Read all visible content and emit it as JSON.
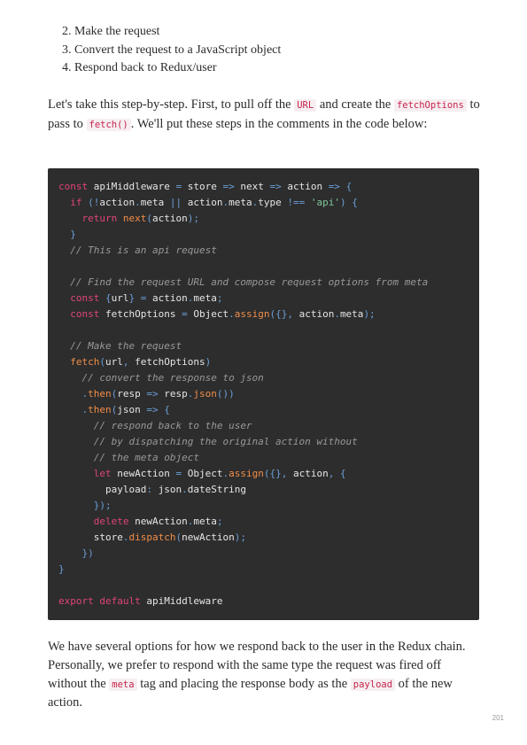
{
  "steps": [
    {
      "num": "2.",
      "text": "Make the request"
    },
    {
      "num": "3.",
      "text": "Convert the request to a JavaScript object"
    },
    {
      "num": "4.",
      "text": "Respond back to Redux/user"
    }
  ],
  "intro": {
    "t1": "Let's take this step-by-step. First, to pull off the ",
    "c1": "URL",
    "t2": " and create the ",
    "c2": "fetchOptions",
    "t3": " to pass to ",
    "c3": "fetch()",
    "t4": ". We'll put these steps in the comments in the code below:"
  },
  "code_lines": [
    [
      [
        "k",
        "const"
      ],
      [
        "t",
        " apiMiddleware "
      ],
      [
        "p",
        "="
      ],
      [
        "t",
        " store "
      ],
      [
        "p",
        "=>"
      ],
      [
        "t",
        " next "
      ],
      [
        "p",
        "=>"
      ],
      [
        "t",
        " action "
      ],
      [
        "p",
        "=>"
      ],
      [
        "t",
        " "
      ],
      [
        "p",
        "{"
      ]
    ],
    [
      [
        "t",
        "  "
      ],
      [
        "k",
        "if"
      ],
      [
        "t",
        " "
      ],
      [
        "p",
        "(!"
      ],
      [
        "t",
        "action"
      ],
      [
        "p",
        "."
      ],
      [
        "t",
        "meta "
      ],
      [
        "p",
        "||"
      ],
      [
        "t",
        " action"
      ],
      [
        "p",
        "."
      ],
      [
        "t",
        "meta"
      ],
      [
        "p",
        "."
      ],
      [
        "t",
        "type "
      ],
      [
        "p",
        "!=="
      ],
      [
        "t",
        " "
      ],
      [
        "s",
        "'api'"
      ],
      [
        "p",
        ")"
      ],
      [
        "t",
        " "
      ],
      [
        "p",
        "{"
      ]
    ],
    [
      [
        "t",
        "    "
      ],
      [
        "k",
        "return"
      ],
      [
        "t",
        " "
      ],
      [
        "f",
        "next"
      ],
      [
        "p",
        "("
      ],
      [
        "t",
        "action"
      ],
      [
        "p",
        ");"
      ]
    ],
    [
      [
        "t",
        "  "
      ],
      [
        "p",
        "}"
      ]
    ],
    [
      [
        "t",
        "  "
      ],
      [
        "c",
        "// This is an api request"
      ]
    ],
    [
      [
        "t",
        ""
      ]
    ],
    [
      [
        "t",
        "  "
      ],
      [
        "c",
        "// Find the request URL and compose request options from meta"
      ]
    ],
    [
      [
        "t",
        "  "
      ],
      [
        "k",
        "const"
      ],
      [
        "t",
        " "
      ],
      [
        "p",
        "{"
      ],
      [
        "t",
        "url"
      ],
      [
        "p",
        "}"
      ],
      [
        "t",
        " "
      ],
      [
        "p",
        "="
      ],
      [
        "t",
        " action"
      ],
      [
        "p",
        "."
      ],
      [
        "t",
        "meta"
      ],
      [
        "p",
        ";"
      ]
    ],
    [
      [
        "t",
        "  "
      ],
      [
        "k",
        "const"
      ],
      [
        "t",
        " fetchOptions "
      ],
      [
        "p",
        "="
      ],
      [
        "t",
        " Object"
      ],
      [
        "p",
        "."
      ],
      [
        "f",
        "assign"
      ],
      [
        "p",
        "({},"
      ],
      [
        "t",
        " action"
      ],
      [
        "p",
        "."
      ],
      [
        "t",
        "meta"
      ],
      [
        "p",
        ");"
      ]
    ],
    [
      [
        "t",
        ""
      ]
    ],
    [
      [
        "t",
        "  "
      ],
      [
        "c",
        "// Make the request"
      ]
    ],
    [
      [
        "t",
        "  "
      ],
      [
        "f",
        "fetch"
      ],
      [
        "p",
        "("
      ],
      [
        "t",
        "url"
      ],
      [
        "p",
        ","
      ],
      [
        "t",
        " fetchOptions"
      ],
      [
        "p",
        ")"
      ]
    ],
    [
      [
        "t",
        "    "
      ],
      [
        "c",
        "// convert the response to json"
      ]
    ],
    [
      [
        "t",
        "    "
      ],
      [
        "p",
        "."
      ],
      [
        "f",
        "then"
      ],
      [
        "p",
        "("
      ],
      [
        "t",
        "resp "
      ],
      [
        "p",
        "=>"
      ],
      [
        "t",
        " resp"
      ],
      [
        "p",
        "."
      ],
      [
        "f",
        "json"
      ],
      [
        "p",
        "())"
      ]
    ],
    [
      [
        "t",
        "    "
      ],
      [
        "p",
        "."
      ],
      [
        "f",
        "then"
      ],
      [
        "p",
        "("
      ],
      [
        "t",
        "json "
      ],
      [
        "p",
        "=>"
      ],
      [
        "t",
        " "
      ],
      [
        "p",
        "{"
      ]
    ],
    [
      [
        "t",
        "      "
      ],
      [
        "c",
        "// respond back to the user"
      ]
    ],
    [
      [
        "t",
        "      "
      ],
      [
        "c",
        "// by dispatching the original action without"
      ]
    ],
    [
      [
        "t",
        "      "
      ],
      [
        "c",
        "// the meta object"
      ]
    ],
    [
      [
        "t",
        "      "
      ],
      [
        "k",
        "let"
      ],
      [
        "t",
        " newAction "
      ],
      [
        "p",
        "="
      ],
      [
        "t",
        " Object"
      ],
      [
        "p",
        "."
      ],
      [
        "f",
        "assign"
      ],
      [
        "p",
        "({},"
      ],
      [
        "t",
        " action"
      ],
      [
        "p",
        ","
      ],
      [
        "t",
        " "
      ],
      [
        "p",
        "{"
      ]
    ],
    [
      [
        "t",
        "        payload"
      ],
      [
        "p",
        ":"
      ],
      [
        "t",
        " json"
      ],
      [
        "p",
        "."
      ],
      [
        "t",
        "dateString"
      ]
    ],
    [
      [
        "t",
        "      "
      ],
      [
        "p",
        "});"
      ]
    ],
    [
      [
        "t",
        "      "
      ],
      [
        "k",
        "delete"
      ],
      [
        "t",
        " newAction"
      ],
      [
        "p",
        "."
      ],
      [
        "t",
        "meta"
      ],
      [
        "p",
        ";"
      ]
    ],
    [
      [
        "t",
        "      store"
      ],
      [
        "p",
        "."
      ],
      [
        "f",
        "dispatch"
      ],
      [
        "p",
        "("
      ],
      [
        "t",
        "newAction"
      ],
      [
        "p",
        ");"
      ]
    ],
    [
      [
        "t",
        "    "
      ],
      [
        "p",
        "})"
      ]
    ],
    [
      [
        "p",
        "}"
      ]
    ],
    [
      [
        "t",
        ""
      ]
    ],
    [
      [
        "k",
        "export"
      ],
      [
        "t",
        " "
      ],
      [
        "k",
        "default"
      ],
      [
        "t",
        " apiMiddleware"
      ]
    ]
  ],
  "outro": {
    "t1": "We have several options for how we respond back to the user in the Redux chain. Personally, we prefer to respond with the same type the request was fired off without the ",
    "c1": "meta",
    "t2": " tag and placing the response body as the ",
    "c2": "payload",
    "t3": " of the new action."
  },
  "page_number": "201"
}
